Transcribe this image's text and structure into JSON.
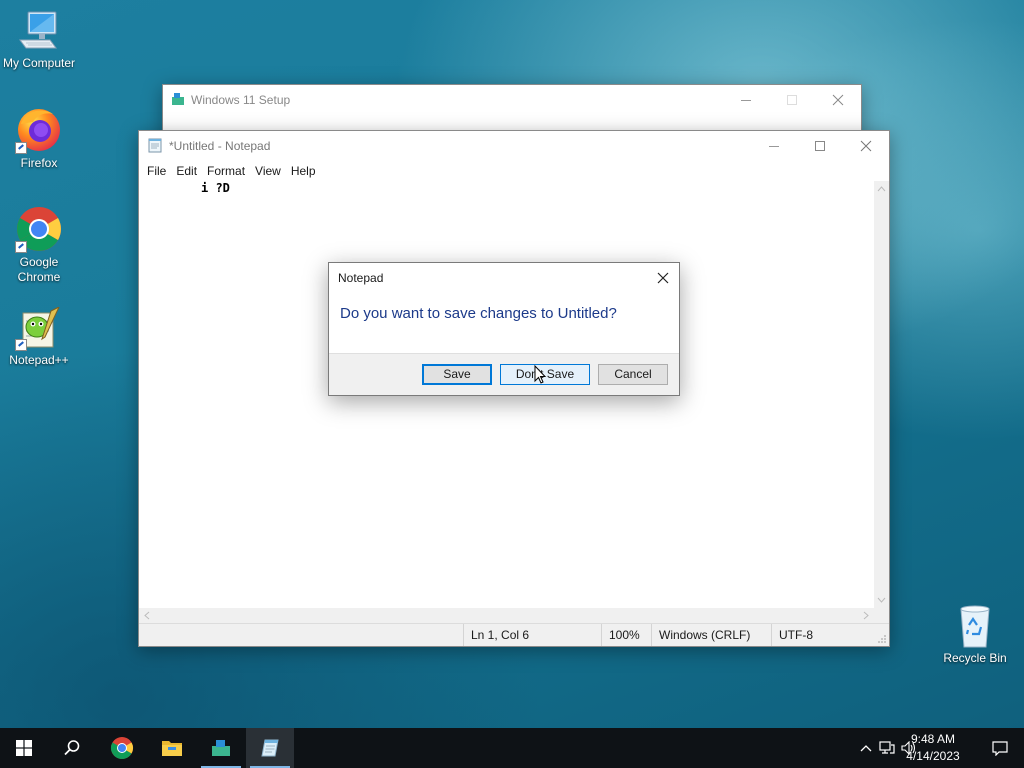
{
  "desktop": {
    "icons": [
      {
        "label": "My Computer",
        "icon": "computer-icon"
      },
      {
        "label": "Firefox",
        "icon": "firefox-icon"
      },
      {
        "label": "Google\nChrome",
        "label_line1": "Google",
        "label_line2": "Chrome",
        "icon": "chrome-icon"
      },
      {
        "label": "Notepad++",
        "icon": "notepadpp-icon"
      },
      {
        "label": "Recycle Bin",
        "icon": "recycle-bin-icon"
      }
    ]
  },
  "setup_window": {
    "title": "Windows 11 Setup"
  },
  "notepad": {
    "title": "*Untitled - Notepad",
    "menu": [
      "File",
      "Edit",
      "Format",
      "View",
      "Help"
    ],
    "content": "i ?D",
    "status": {
      "position": "Ln 1, Col 6",
      "zoom": "100%",
      "line_ending": "Windows (CRLF)",
      "encoding": "UTF-8"
    }
  },
  "dialog": {
    "title": "Notepad",
    "message": "Do you want to save changes to Untitled?",
    "buttons": {
      "save": "Save",
      "dont_save": "Don't Save",
      "cancel": "Cancel"
    }
  },
  "taskbar": {
    "clock_time": "9:48 AM",
    "clock_date": "4/14/2023",
    "apps": [
      "start-icon",
      "search-icon",
      "chrome-icon",
      "file-explorer-icon",
      "windows-setup-icon",
      "notepad-icon"
    ]
  },
  "colors": {
    "accent": "#0078d7",
    "dialog_message": "#1c3a8a",
    "taskbar": "#0e1216"
  }
}
